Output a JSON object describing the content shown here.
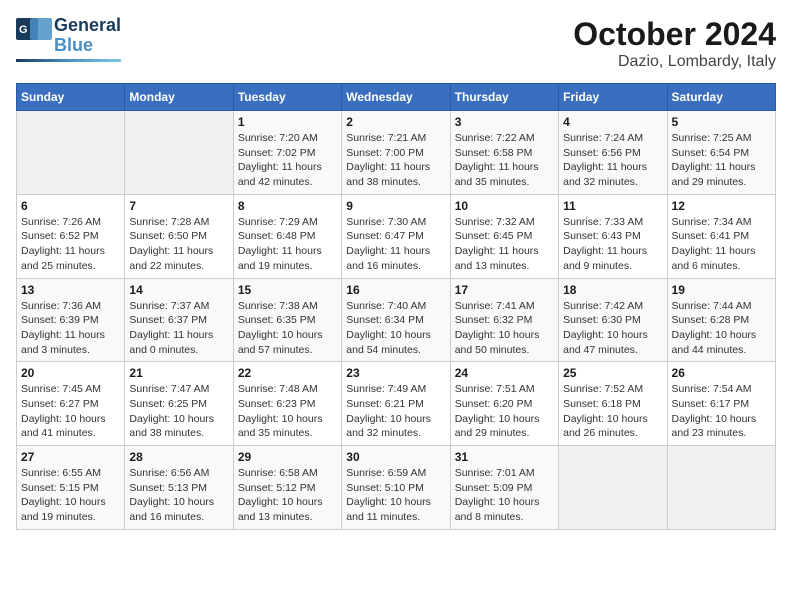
{
  "header": {
    "logo_general": "General",
    "logo_blue": "Blue",
    "title": "October 2024",
    "subtitle": "Dazio, Lombardy, Italy"
  },
  "weekdays": [
    "Sunday",
    "Monday",
    "Tuesday",
    "Wednesday",
    "Thursday",
    "Friday",
    "Saturday"
  ],
  "weeks": [
    [
      {
        "day": "",
        "empty": true
      },
      {
        "day": "",
        "empty": true
      },
      {
        "day": "1",
        "sunrise": "7:20 AM",
        "sunset": "7:02 PM",
        "daylight": "11 hours and 42 minutes."
      },
      {
        "day": "2",
        "sunrise": "7:21 AM",
        "sunset": "7:00 PM",
        "daylight": "11 hours and 38 minutes."
      },
      {
        "day": "3",
        "sunrise": "7:22 AM",
        "sunset": "6:58 PM",
        "daylight": "11 hours and 35 minutes."
      },
      {
        "day": "4",
        "sunrise": "7:24 AM",
        "sunset": "6:56 PM",
        "daylight": "11 hours and 32 minutes."
      },
      {
        "day": "5",
        "sunrise": "7:25 AM",
        "sunset": "6:54 PM",
        "daylight": "11 hours and 29 minutes."
      }
    ],
    [
      {
        "day": "6",
        "sunrise": "7:26 AM",
        "sunset": "6:52 PM",
        "daylight": "11 hours and 25 minutes."
      },
      {
        "day": "7",
        "sunrise": "7:28 AM",
        "sunset": "6:50 PM",
        "daylight": "11 hours and 22 minutes."
      },
      {
        "day": "8",
        "sunrise": "7:29 AM",
        "sunset": "6:48 PM",
        "daylight": "11 hours and 19 minutes."
      },
      {
        "day": "9",
        "sunrise": "7:30 AM",
        "sunset": "6:47 PM",
        "daylight": "11 hours and 16 minutes."
      },
      {
        "day": "10",
        "sunrise": "7:32 AM",
        "sunset": "6:45 PM",
        "daylight": "11 hours and 13 minutes."
      },
      {
        "day": "11",
        "sunrise": "7:33 AM",
        "sunset": "6:43 PM",
        "daylight": "11 hours and 9 minutes."
      },
      {
        "day": "12",
        "sunrise": "7:34 AM",
        "sunset": "6:41 PM",
        "daylight": "11 hours and 6 minutes."
      }
    ],
    [
      {
        "day": "13",
        "sunrise": "7:36 AM",
        "sunset": "6:39 PM",
        "daylight": "11 hours and 3 minutes."
      },
      {
        "day": "14",
        "sunrise": "7:37 AM",
        "sunset": "6:37 PM",
        "daylight": "11 hours and 0 minutes."
      },
      {
        "day": "15",
        "sunrise": "7:38 AM",
        "sunset": "6:35 PM",
        "daylight": "10 hours and 57 minutes."
      },
      {
        "day": "16",
        "sunrise": "7:40 AM",
        "sunset": "6:34 PM",
        "daylight": "10 hours and 54 minutes."
      },
      {
        "day": "17",
        "sunrise": "7:41 AM",
        "sunset": "6:32 PM",
        "daylight": "10 hours and 50 minutes."
      },
      {
        "day": "18",
        "sunrise": "7:42 AM",
        "sunset": "6:30 PM",
        "daylight": "10 hours and 47 minutes."
      },
      {
        "day": "19",
        "sunrise": "7:44 AM",
        "sunset": "6:28 PM",
        "daylight": "10 hours and 44 minutes."
      }
    ],
    [
      {
        "day": "20",
        "sunrise": "7:45 AM",
        "sunset": "6:27 PM",
        "daylight": "10 hours and 41 minutes."
      },
      {
        "day": "21",
        "sunrise": "7:47 AM",
        "sunset": "6:25 PM",
        "daylight": "10 hours and 38 minutes."
      },
      {
        "day": "22",
        "sunrise": "7:48 AM",
        "sunset": "6:23 PM",
        "daylight": "10 hours and 35 minutes."
      },
      {
        "day": "23",
        "sunrise": "7:49 AM",
        "sunset": "6:21 PM",
        "daylight": "10 hours and 32 minutes."
      },
      {
        "day": "24",
        "sunrise": "7:51 AM",
        "sunset": "6:20 PM",
        "daylight": "10 hours and 29 minutes."
      },
      {
        "day": "25",
        "sunrise": "7:52 AM",
        "sunset": "6:18 PM",
        "daylight": "10 hours and 26 minutes."
      },
      {
        "day": "26",
        "sunrise": "7:54 AM",
        "sunset": "6:17 PM",
        "daylight": "10 hours and 23 minutes."
      }
    ],
    [
      {
        "day": "27",
        "sunrise": "6:55 AM",
        "sunset": "5:15 PM",
        "daylight": "10 hours and 19 minutes."
      },
      {
        "day": "28",
        "sunrise": "6:56 AM",
        "sunset": "5:13 PM",
        "daylight": "10 hours and 16 minutes."
      },
      {
        "day": "29",
        "sunrise": "6:58 AM",
        "sunset": "5:12 PM",
        "daylight": "10 hours and 13 minutes."
      },
      {
        "day": "30",
        "sunrise": "6:59 AM",
        "sunset": "5:10 PM",
        "daylight": "10 hours and 11 minutes."
      },
      {
        "day": "31",
        "sunrise": "7:01 AM",
        "sunset": "5:09 PM",
        "daylight": "10 hours and 8 minutes."
      },
      {
        "day": "",
        "empty": true
      },
      {
        "day": "",
        "empty": true
      }
    ]
  ]
}
